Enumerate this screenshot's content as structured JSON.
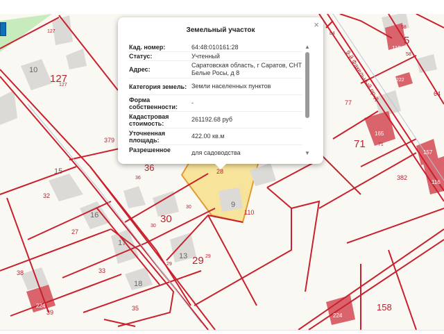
{
  "popup": {
    "title": "Земельный участок",
    "close": "×",
    "rows": [
      {
        "label": "Кад. номер:",
        "value": "64:48:010161:28"
      },
      {
        "label": "Статус:",
        "value": "Учтенный"
      },
      {
        "label": "Адрес:",
        "value": "Саратовская область, г Саратов, СНТ Белые Росы, д 8"
      },
      {
        "label": "Категория земель:",
        "value": "Земли населенных пунктов"
      },
      {
        "label": "Форма собственности:",
        "value": "-"
      },
      {
        "label": "Кадастровая стоимость:",
        "value": "261192.68 руб"
      },
      {
        "label": "Уточненная площадь:",
        "value": "422.00 кв.м"
      },
      {
        "label": "Разрешенное использование:",
        "value": "для садоводства"
      }
    ]
  },
  "map": {
    "street": "9-й Факельный пр-д",
    "labels": [
      "10",
      "127",
      "127",
      "127",
      "379",
      "15",
      "32",
      "16",
      "27",
      "17",
      "33",
      "18",
      "35",
      "38",
      "39",
      "224",
      "36",
      "36",
      "30",
      "30",
      "30",
      "13",
      "29",
      "29",
      "29",
      "9",
      "110",
      "28",
      "84",
      "58",
      "58",
      "5",
      "115",
      "77",
      "71",
      "71",
      "165",
      "157",
      "116",
      "382",
      "158",
      "224",
      "64",
      "222"
    ]
  },
  "colors": {
    "parcel_line": "#c8202c",
    "selected_fill": "#f6e08a",
    "building": "#dcdad6",
    "red_building": "#d9646c"
  }
}
